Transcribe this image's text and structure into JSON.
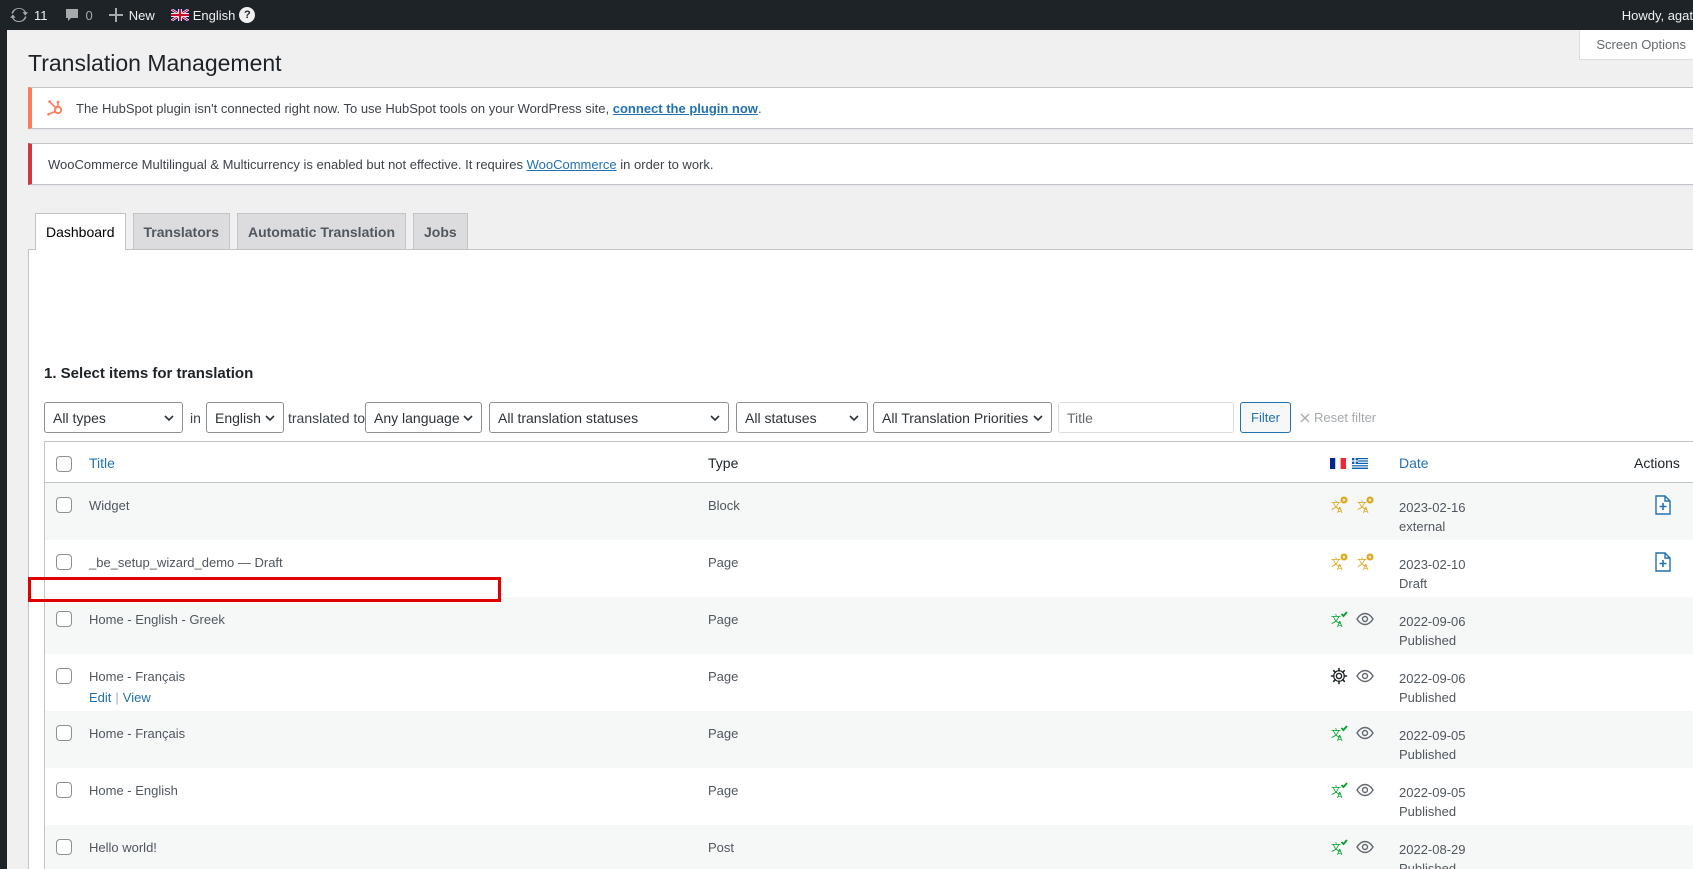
{
  "adminbar": {
    "updates_count": "11",
    "comments_count": "0",
    "new_label": "New",
    "language_label": "English",
    "help_label": "?",
    "howdy": "Howdy, agat"
  },
  "screen_options": "Screen Options",
  "page_title": "Translation Management",
  "notices": {
    "hubspot_text": "The HubSpot plugin isn't connected right now. To use HubSpot tools on your WordPress site,",
    "hubspot_link": "connect the plugin now",
    "hubspot_end": ".",
    "woo_text": "WooCommerce Multilingual & Multicurrency is enabled but not effective. It requires",
    "woo_link": "WooCommerce",
    "woo_end": "in order to work."
  },
  "tabs": [
    {
      "label": "Dashboard"
    },
    {
      "label": "Translators"
    },
    {
      "label": "Automatic Translation"
    },
    {
      "label": "Jobs"
    }
  ],
  "section_title": "1. Select items for translation",
  "filters": {
    "type": "All types",
    "in_label": "in",
    "language": "English",
    "translated_to_label": "translated to",
    "target_language": "Any language",
    "translation_status": "All translation statuses",
    "status": "All statuses",
    "priority": "All Translation Priorities",
    "title_placeholder": "Title",
    "filter_button": "Filter",
    "reset_filter": "Reset filter"
  },
  "table": {
    "headers": {
      "title": "Title",
      "type": "Type",
      "date": "Date",
      "actions": "Actions"
    },
    "rows": [
      {
        "title": "Widget",
        "type": "Block",
        "date": "2023-02-16",
        "status": "external",
        "icons": [
          "needs-translation-icon",
          "needs-translation-icon"
        ],
        "action": true
      },
      {
        "title": "_be_setup_wizard_demo — Draft",
        "type": "Page",
        "date": "2023-02-10",
        "status": "Draft",
        "icons": [
          "needs-translation-icon",
          "needs-translation-icon"
        ],
        "action": true
      },
      {
        "title": "Home - English - Greek",
        "type": "Page",
        "date": "2022-09-06",
        "status": "Published",
        "icons": [
          "translated-icon",
          "view-icon"
        ],
        "action": false
      },
      {
        "title": "Home - Français",
        "type": "Page",
        "date": "2022-09-06",
        "status": "Published",
        "icons": [
          "settings-gear-icon",
          "view-icon"
        ],
        "action": false,
        "row_actions": {
          "edit": "Edit",
          "sep": "|",
          "view": "View"
        }
      },
      {
        "title": "Home - Français",
        "type": "Page",
        "date": "2022-09-05",
        "status": "Published",
        "icons": [
          "translated-icon",
          "view-icon"
        ],
        "action": false
      },
      {
        "title": "Home - English",
        "type": "Page",
        "date": "2022-09-05",
        "status": "Published",
        "icons": [
          "translated-icon",
          "view-icon"
        ],
        "action": false
      },
      {
        "title": "Hello world!",
        "type": "Post",
        "date": "2022-08-29",
        "status": "Published",
        "icons": [
          "translated-icon",
          "view-icon"
        ],
        "action": false
      }
    ]
  },
  "colors": {
    "accent": "#2271b1",
    "notice_error": "#d63638",
    "hubspot": "#ff7a59",
    "needs_translation": "#dba617",
    "translated": "#00a32a",
    "highlight": "#e00000"
  }
}
